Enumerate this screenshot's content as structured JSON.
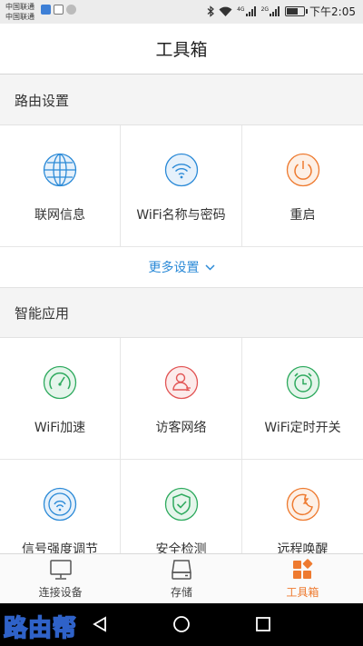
{
  "status_bar": {
    "carrier_1": "中国联通",
    "carrier_2": "中国联通",
    "net_tag_1": "4G",
    "net_tag_2": "2G",
    "time": "下午2:05",
    "battery_level": 0.6
  },
  "title": "工具箱",
  "router_section": {
    "title": "路由设置",
    "items": [
      {
        "label": "联网信息",
        "icon": "globe-icon",
        "color": "#2b8ad7"
      },
      {
        "label": "WiFi名称与密码",
        "icon": "wifi-icon",
        "color": "#2b8ad7"
      },
      {
        "label": "重启",
        "icon": "power-icon",
        "color": "#ee7a2f"
      }
    ],
    "more_label": "更多设置"
  },
  "smart_section": {
    "title": "智能应用",
    "items": [
      {
        "label": "WiFi加速",
        "icon": "speedometer-icon",
        "color": "#2eaa5e"
      },
      {
        "label": "访客网络",
        "icon": "guest-user-icon",
        "color": "#e25555"
      },
      {
        "label": "WiFi定时开关",
        "icon": "alarm-clock-icon",
        "color": "#2eaa5e"
      },
      {
        "label": "信号强度调节",
        "icon": "signal-wifi-icon",
        "color": "#2b8ad7"
      },
      {
        "label": "安全检测",
        "icon": "shield-check-icon",
        "color": "#2eaa5e"
      },
      {
        "label": "远程唤醒",
        "icon": "moon-sleep-icon",
        "color": "#ee7a2f"
      }
    ]
  },
  "bottom_nav": {
    "items": [
      {
        "label": "连接设备",
        "icon": "monitor-icon",
        "active": false
      },
      {
        "label": "存储",
        "icon": "storage-drive-icon",
        "active": false
      },
      {
        "label": "工具箱",
        "icon": "toolbox-grid-icon",
        "active": true
      }
    ]
  },
  "watermark": "路由帮",
  "colors": {
    "accent_blue": "#2b8ad7",
    "accent_orange": "#ee7a2f",
    "accent_green": "#2eaa5e",
    "accent_red": "#e25555"
  }
}
